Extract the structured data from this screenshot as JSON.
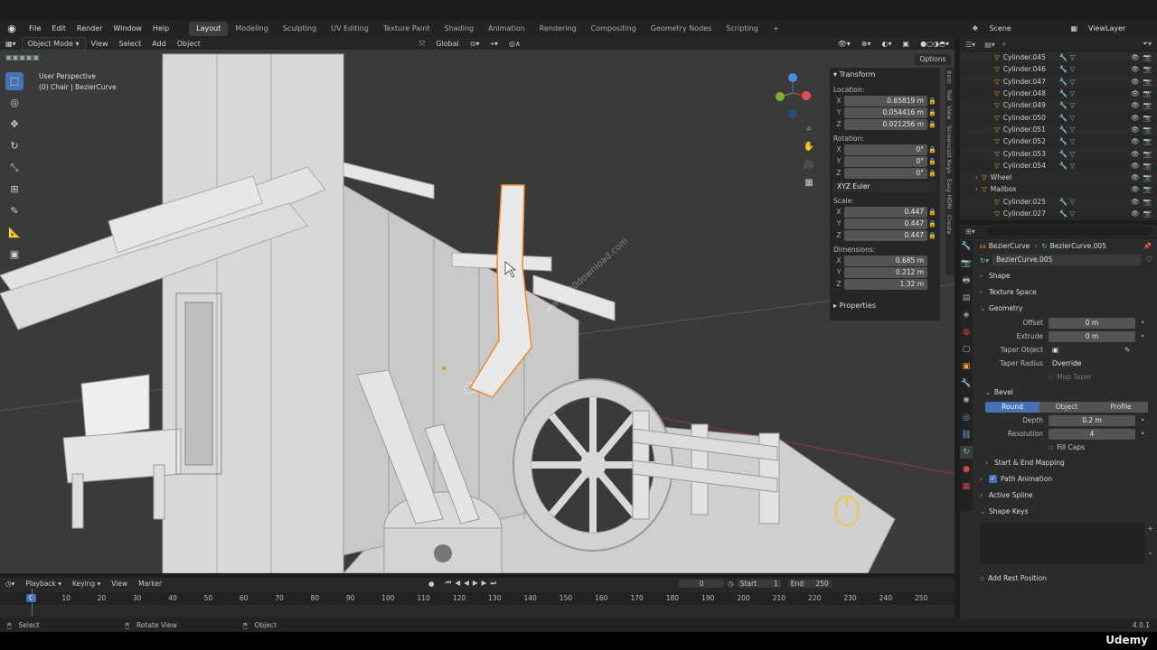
{
  "app": {
    "menus": [
      "File",
      "Edit",
      "Render",
      "Window",
      "Help"
    ],
    "workspaces": [
      "Layout",
      "Modeling",
      "Sculpting",
      "UV Editing",
      "Texture Paint",
      "Shading",
      "Animation",
      "Rendering",
      "Compositing",
      "Geometry Nodes",
      "Scripting"
    ],
    "active_workspace": "Layout",
    "scene": "Scene",
    "view_layer": "ViewLayer"
  },
  "viewport": {
    "mode": "Object Mode",
    "header_menus": [
      "View",
      "Select",
      "Add",
      "Object"
    ],
    "orientation": "Global",
    "options_label": "Options",
    "perspective": "User Perspective",
    "context": "(0) Chair | BezierCurve",
    "watermark": "www.p30download.com"
  },
  "transform_panel": {
    "title": "Transform",
    "location_label": "Location:",
    "location": {
      "x": "0.65819 m",
      "y": "0.054416 m",
      "z": "0.021256 m"
    },
    "rotation_label": "Rotation:",
    "rotation": {
      "x": "0°",
      "y": "0°",
      "z": "0°"
    },
    "rotation_mode": "XYZ Euler",
    "scale_label": "Scale:",
    "scale": {
      "x": "0.447",
      "y": "0.447",
      "z": "0.447"
    },
    "dimensions_label": "Dimensions:",
    "dimensions": {
      "x": "0.685 m",
      "y": "0.212 m",
      "z": "1.32 m"
    },
    "properties": "Properties"
  },
  "sidebar_tabs": [
    "Item",
    "Tool",
    "View",
    "Screencast Keys",
    "Easy HDRI",
    "Create"
  ],
  "outliner": {
    "rows": [
      {
        "name": "Cylinder.045",
        "indent": 1
      },
      {
        "name": "Cylinder.046",
        "indent": 1
      },
      {
        "name": "Cylinder.047",
        "indent": 1
      },
      {
        "name": "Cylinder.048",
        "indent": 1
      },
      {
        "name": "Cylinder.049",
        "indent": 1
      },
      {
        "name": "Cylinder.050",
        "indent": 1
      },
      {
        "name": "Cylinder.051",
        "indent": 1
      },
      {
        "name": "Cylinder.052",
        "indent": 1
      },
      {
        "name": "Cylinder.053",
        "indent": 1
      },
      {
        "name": "Cylinder.054",
        "indent": 1
      },
      {
        "name": "Wheel",
        "indent": 0
      },
      {
        "name": "Mailbox",
        "indent": 0
      },
      {
        "name": "Cylinder.025",
        "indent": 1
      },
      {
        "name": "Cylinder.027",
        "indent": 1
      }
    ]
  },
  "properties": {
    "breadcrumb_object": "BezierCurve",
    "breadcrumb_data": "BezierCurve.005",
    "data_name": "BezierCurve.005",
    "sections": {
      "shape": "Shape",
      "texture_space": "Texture Space",
      "geometry": "Geometry",
      "bevel": "Bevel",
      "start_end": "Start & End Mapping",
      "path_animation": "Path Animation",
      "active_spline": "Active Spline",
      "shape_keys": "Shape Keys",
      "add_rest": "Add Rest Position"
    },
    "geometry": {
      "offset_label": "Offset",
      "offset": "0 m",
      "extrude_label": "Extrude",
      "extrude": "0 m",
      "taper_object_label": "Taper Object",
      "taper_radius_label": "Taper Radius",
      "taper_radius": "Override",
      "map_taper": "Map Taper"
    },
    "bevel": {
      "modes": [
        "Round",
        "Object",
        "Profile"
      ],
      "active_mode": "Round",
      "depth_label": "Depth",
      "depth": "0.2 m",
      "resolution_label": "Resolution",
      "resolution": "4",
      "fill_caps": "Fill Caps"
    }
  },
  "timeline": {
    "menus": [
      "Playback",
      "Keying",
      "View",
      "Marker"
    ],
    "current_frame": "0",
    "start_label": "Start",
    "start": "1",
    "end_label": "End",
    "end": "250",
    "ticks": [
      "0",
      "10",
      "20",
      "30",
      "40",
      "50",
      "60",
      "70",
      "80",
      "90",
      "100",
      "110",
      "120",
      "130",
      "140",
      "150",
      "160",
      "170",
      "180",
      "190",
      "200",
      "210",
      "220",
      "230",
      "240",
      "250"
    ]
  },
  "statusbar": {
    "select": "Select",
    "rotate": "Rotate View",
    "object": "Object",
    "version": "4.0.1"
  },
  "brand": "Udemy"
}
